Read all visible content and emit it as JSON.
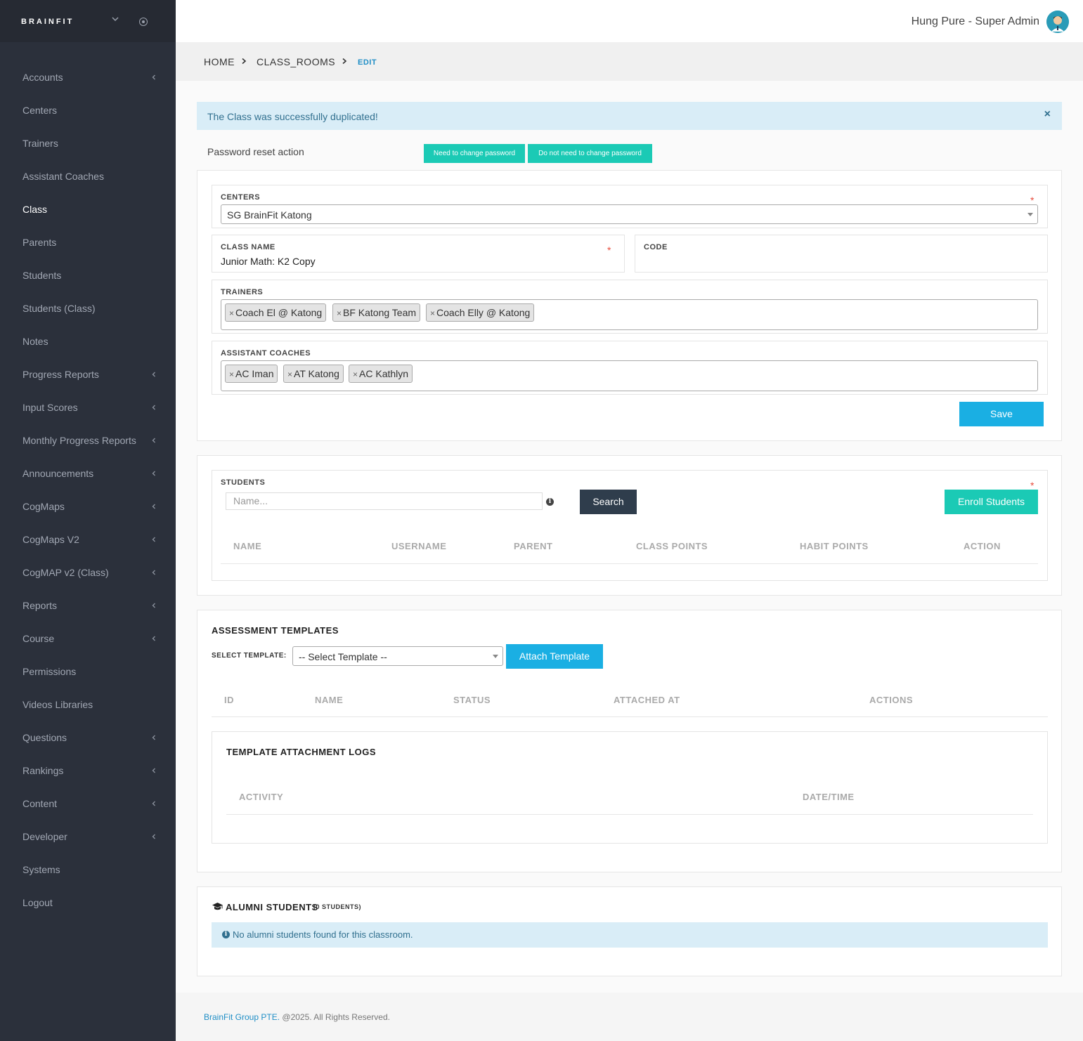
{
  "sidebar": {
    "logo": "BRAINFIT",
    "items": [
      {
        "label": "Accounts",
        "chevron": true
      },
      {
        "label": "Centers",
        "chevron": false
      },
      {
        "label": "Trainers",
        "chevron": false
      },
      {
        "label": "Assistant Coaches",
        "chevron": false
      },
      {
        "label": "Class",
        "chevron": false,
        "active": true
      },
      {
        "label": "Parents",
        "chevron": false
      },
      {
        "label": "Students",
        "chevron": false
      },
      {
        "label": "Students (Class)",
        "chevron": false
      },
      {
        "label": "Notes",
        "chevron": false
      },
      {
        "label": "Progress Reports",
        "chevron": true
      },
      {
        "label": "Input Scores",
        "chevron": true
      },
      {
        "label": "Monthly Progress Reports",
        "chevron": true
      },
      {
        "label": "Announcements",
        "chevron": true
      },
      {
        "label": "CogMaps",
        "chevron": true
      },
      {
        "label": "CogMaps V2",
        "chevron": true
      },
      {
        "label": "CogMAP v2 (Class)",
        "chevron": true
      },
      {
        "label": "Reports",
        "chevron": true
      },
      {
        "label": "Course",
        "chevron": true
      },
      {
        "label": "Permissions",
        "chevron": false
      },
      {
        "label": "Videos Libraries",
        "chevron": false
      },
      {
        "label": "Questions",
        "chevron": true
      },
      {
        "label": "Rankings",
        "chevron": true
      },
      {
        "label": "Content",
        "chevron": true
      },
      {
        "label": "Developer",
        "chevron": true
      },
      {
        "label": "Systems",
        "chevron": false
      },
      {
        "label": "Logout",
        "chevron": false
      }
    ]
  },
  "header": {
    "user": "Hung Pure - Super Admin"
  },
  "breadcrumb": {
    "home": "HOME",
    "class_rooms": "CLASS_ROOMS",
    "edit": "EDIT"
  },
  "alert": {
    "message": "The Class was successfully duplicated!",
    "close": "×"
  },
  "password_reset": {
    "label": "Password reset action",
    "need_change": "Need to change password",
    "no_need_change": "Do not need to change password"
  },
  "form": {
    "centers_label": "CENTERS",
    "centers_value": "SG BrainFit Katong",
    "class_name_label": "CLASS NAME",
    "class_name_value": "Junior Math: K2 Copy",
    "code_label": "CODE",
    "code_value": "",
    "trainers_label": "TRAINERS",
    "trainers": [
      "Coach El @ Katong",
      "BF Katong Team",
      "Coach Elly @ Katong"
    ],
    "assistant_coaches_label": "ASSISTANT COACHES",
    "assistant_coaches": [
      "AC Iman",
      "AT Katong",
      "AC Kathlyn"
    ],
    "required_mark": "*",
    "tag_remove": "×",
    "save": "Save"
  },
  "students": {
    "label": "STUDENTS",
    "search_placeholder": "Name...",
    "search_button": "Search",
    "enroll_button": "Enroll Students",
    "columns": [
      "NAME",
      "USERNAME",
      "PARENT",
      "CLASS POINTS",
      "HABIT POINTS",
      "ACTION"
    ]
  },
  "assessment": {
    "title": "ASSESSMENT TEMPLATES",
    "select_label": "SELECT TEMPLATE:",
    "select_value": "-- Select Template --",
    "attach_button": "Attach Template",
    "columns": [
      "ID",
      "NAME",
      "STATUS",
      "ATTACHED AT",
      "ACTIONS"
    ],
    "logs_title": "TEMPLATE ATTACHMENT LOGS",
    "logs_columns": [
      "ACTIVITY",
      "DATE/TIME"
    ]
  },
  "alumni": {
    "title": "ALUMNI STUDENTS",
    "count": "(0 STUDENTS)",
    "empty_message": "No alumni students found for this classroom."
  },
  "footer": {
    "company": "BrainFit Group PTE.",
    "rights": " @2025. All Rights Reserved."
  },
  "colors": {
    "sidebar_bg": "#2b303b",
    "primary_blue": "#1aafe3",
    "teal": "#1bcab5",
    "dark_button": "#2f3d4c",
    "info_bg": "#d9edf7"
  }
}
